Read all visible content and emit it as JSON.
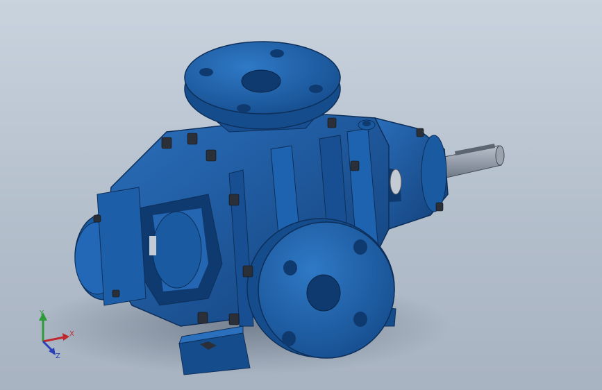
{
  "viewport": {
    "background_top": "#c9d3de",
    "background_bottom": "#a8b3c2"
  },
  "model": {
    "body_color": "#1c5fa8",
    "shadow_color": "#0d2f5a",
    "highlight_color": "#3f86d0",
    "shaft_color": "#8c96a4",
    "bolt_color": "#2a2f38"
  },
  "triad": {
    "x_label": "X",
    "y_label": "Y",
    "z_label": "Z",
    "x_color": "#c0282d",
    "y_color": "#2e9a3a",
    "z_color": "#2a3fb8"
  }
}
